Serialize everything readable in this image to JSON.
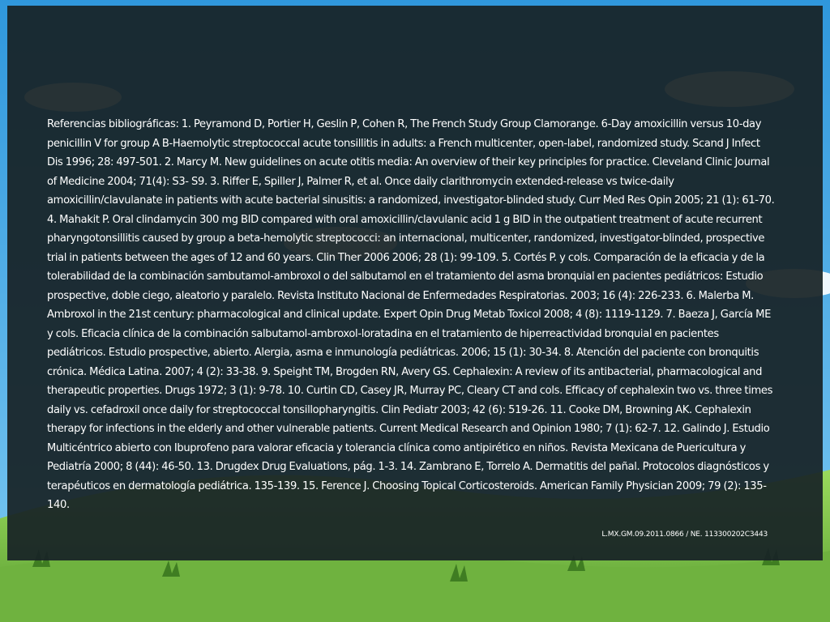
{
  "references": {
    "text": "Referencias bibliográficas: 1. Peyramond D, Portier H, Geslin P, Cohen R, The French Study Group Clamorange. 6-Day amoxicillin versus 10-day penicillin V for group A B-Haemolytic streptococcal acute tonsillitis in adults: a French multicenter, open-label, randomized study. Scand J Infect Dis 1996; 28: 497-501. 2. Marcy M. New guidelines on acute otitis media: An overview of their key principles for practice. Cleveland Clinic Journal of Medicine 2004; 71(4): S3- S9. 3. Riffer E, Spiller J, Palmer R, et al. Once daily clarithromycin extended-release vs twice-daily amoxicillin/clavulanate in patients with acute bacterial sinusitis: a randomized, investigator-blinded study. Curr Med Res Opin 2005; 21 (1): 61-70. 4.  Mahakit P. Oral clindamycin 300 mg BID compared with oral amoxicillin/clavulanic acid 1 g BID in the outpatient treatment of acute recurrent pharyngotonsillitis caused by group a beta-hemolytic streptococci: an internacional, multicenter, randomized, investigator-blinded, prospective trial in patients between the ages of 12 and 60 years. Clin Ther 2006 2006; 28 (1): 99-109. 5. Cortés P. y cols. Comparación de la eficacia y de la tolerabilidad de la combinación sambutamol-ambroxol o del salbutamol en el tratamiento del asma bronquial en pacientes pediátricos: Estudio prospective, doble ciego, aleatorio y paralelo. Revista Instituto Nacional de Enfermedades Respiratorias. 2003; 16 (4): 226-233. 6. Malerba M. Ambroxol in the 21st century: pharmacological and clinical update. Expert Opin Drug Metab Toxicol 2008; 4 (8): 1119-1129. 7. Baeza J, García ME y cols. Eficacia clínica de la combinación salbutamol-ambroxol-loratadina en el tratamiento de hiperreactividad bronquial en pacientes pediátricos. Estudio prospective, abierto. Alergia, asma e inmunología pediátricas. 2006; 15 (1): 30-34. 8. Atención del paciente con bronquitis crónica. Médica Latina. 2007; 4 (2): 33-38. 9. Speight TM, Brogden RN, Avery GS. Cephalexin: A review of its antibacterial, pharmacological and therapeutic properties. Drugs 1972; 3 (1): 9-78. 10. Curtin CD, Casey JR, Murray PC, Cleary CT and cols. Efficacy of cephalexin two vs. three times daily vs. cefadroxil once daily for streptococcal tonsillopharyngitis. Clin Pediatr 2003; 42 (6): 519-26. 11. Cooke DM, Browning AK. Cephalexin therapy for infections in the elderly and other vulnerable patients. Current Medical Research and Opinion 1980; 7 (1): 62-7. 12. Galindo J. Estudio Multicéntrico abierto con Ibuprofeno para valorar eficacia y tolerancia clínica como antipirético en niños. Revista Mexicana de Puericultura y Pediatría 2000; 8 (44): 46-50. 13. Drugdex Drug Evaluations, pág. 1-3. 14. Zambrano E, Torrelo A. Dermatitis del pañal. Protocolos diagnósticos y terapéuticos en dermatología pediátrica. 135-139. 15. Ference J. Choosing Topical Corticosteroids. American Family Physician 2009; 79 (2): 135-140."
  },
  "footer": {
    "code": "L.MX.GM.09.2011.0866 / NE.  113300202C3443"
  },
  "colors": {
    "overlay": "#182226",
    "text": "#ffffff",
    "sky": "#3aa3e3",
    "grass": "#7cc04a"
  }
}
